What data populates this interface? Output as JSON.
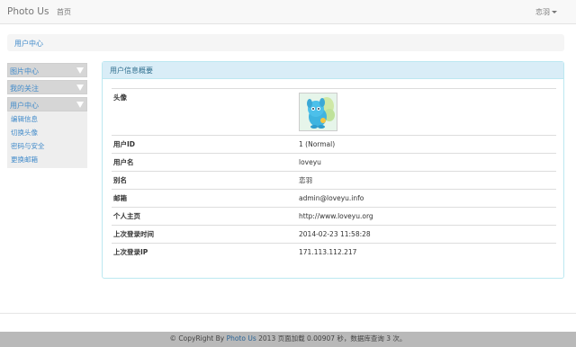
{
  "navbar": {
    "brand": "Photo Us",
    "home": "首页",
    "user": "恋羽"
  },
  "breadcrumb": "用户中心",
  "sidebar": {
    "sections": [
      {
        "label": "图片中心"
      },
      {
        "label": "我的关注"
      },
      {
        "label": "用户中心"
      }
    ],
    "items": [
      "编辑信息",
      "切换头像",
      "密码与安全",
      "更换邮箱"
    ]
  },
  "panel": {
    "title": "用户信息概要",
    "rows": [
      {
        "key": "头像",
        "value": ""
      },
      {
        "key": "用户ID",
        "value": "1 (Normal)"
      },
      {
        "key": "用户名",
        "value": "loveyu"
      },
      {
        "key": "别名",
        "value": "恋羽"
      },
      {
        "key": "邮箱",
        "value": "admin@loveyu.info"
      },
      {
        "key": "个人主页",
        "value": "http://www.loveyu.org"
      },
      {
        "key": "上次登录时间",
        "value": "2014-02-23 11:58:28"
      },
      {
        "key": "上次登录IP",
        "value": "171.113.112.217"
      }
    ]
  },
  "footer": {
    "prefix": "© CopyRight By ",
    "site": "Photo Us",
    "year": " 2013 ",
    "stats": "页面加载 0.00907 秒，数据库查询 3 次。"
  },
  "colors": {
    "link": "#428bca",
    "panel_header_bg": "#d9edf7",
    "panel_border": "#bce8f1"
  }
}
